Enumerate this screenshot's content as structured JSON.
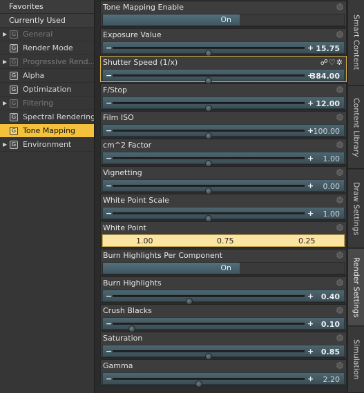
{
  "sidebar": {
    "favorites": "Favorites",
    "currently_used": "Currently Used",
    "items": [
      {
        "label": "General",
        "expandable": true,
        "dim": true
      },
      {
        "label": "Render Mode",
        "expandable": false,
        "dim": false
      },
      {
        "label": "Progressive Rend...",
        "expandable": true,
        "dim": true
      },
      {
        "label": "Alpha",
        "expandable": false,
        "dim": false
      },
      {
        "label": "Optimization",
        "expandable": false,
        "dim": false
      },
      {
        "label": "Filtering",
        "expandable": true,
        "dim": true
      },
      {
        "label": "Spectral Rendering",
        "expandable": false,
        "dim": false
      },
      {
        "label": "Tone Mapping",
        "expandable": false,
        "dim": false,
        "selected": true
      },
      {
        "label": "Environment",
        "expandable": true,
        "dim": false
      }
    ]
  },
  "properties": {
    "tone_mapping_enable": {
      "title": "Tone Mapping Enable",
      "value": "On"
    },
    "exposure_value": {
      "title": "Exposure Value",
      "value": "15.75",
      "level": 0.5
    },
    "shutter_speed": {
      "title": "Shutter Speed (1/x)",
      "value": "384.00",
      "level": 0.5
    },
    "f_stop": {
      "title": "F/Stop",
      "value": "12.00",
      "level": 0.5
    },
    "film_iso": {
      "title": "Film ISO",
      "value": "100.00",
      "level": 0.5
    },
    "cm2_factor": {
      "title": "cm^2 Factor",
      "value": "1.00",
      "level": 0.5
    },
    "vignetting": {
      "title": "Vignetting",
      "value": "0.00",
      "level": 0.5
    },
    "white_point_scale": {
      "title": "White Point Scale",
      "value": "1.00",
      "level": 0.5
    },
    "white_point": {
      "title": "White Point",
      "r": "1.00",
      "g": "0.75",
      "b": "0.25"
    },
    "burn_highlights_per_component": {
      "title": "Burn Highlights Per Component",
      "value": "On"
    },
    "burn_highlights": {
      "title": "Burn Highlights",
      "value": "0.40",
      "level": 0.4
    },
    "crush_blacks": {
      "title": "Crush Blacks",
      "value": "0.10",
      "level": 0.1
    },
    "saturation": {
      "title": "Saturation",
      "value": "0.85",
      "level": 0.5
    },
    "gamma": {
      "title": "Gamma",
      "value": "2.20",
      "level": 0.45
    }
  },
  "right_tabs": [
    {
      "label": "Smart Content"
    },
    {
      "label": "Content Library"
    },
    {
      "label": "Draw Settings"
    },
    {
      "label": "Render Settings",
      "active": true
    },
    {
      "label": "Simulation"
    }
  ],
  "colors": {
    "accent": "#f3c13c",
    "slider": "#4d6670",
    "white_point": "#fbe5a3"
  }
}
